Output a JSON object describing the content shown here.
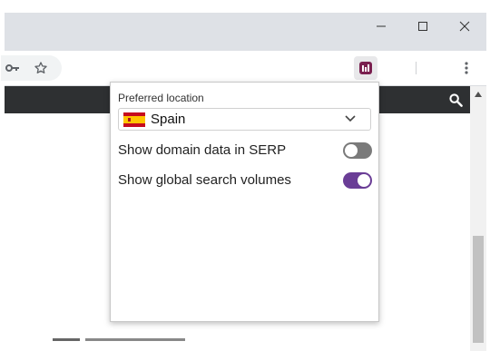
{
  "popup": {
    "preferred_location_label": "Preferred location",
    "location_value": "Spain",
    "setting_1_label": "Show domain data in SERP",
    "setting_1_enabled": false,
    "setting_2_label": "Show global search volumes",
    "setting_2_enabled": true
  },
  "icons": {
    "minimize": "minimize-icon",
    "maximize": "maximize-icon",
    "close": "close-icon",
    "key": "key-icon",
    "star": "star-icon",
    "extension": "keywords-extension-icon",
    "menu": "kebab-menu-icon",
    "search": "search-icon",
    "flag": "spain-flag-icon"
  },
  "colors": {
    "toggle_on": "#6a3d96",
    "toggle_off": "#7a7a7a",
    "page_bar": "#2e3032",
    "extension_icon": "#7a1f4f"
  }
}
